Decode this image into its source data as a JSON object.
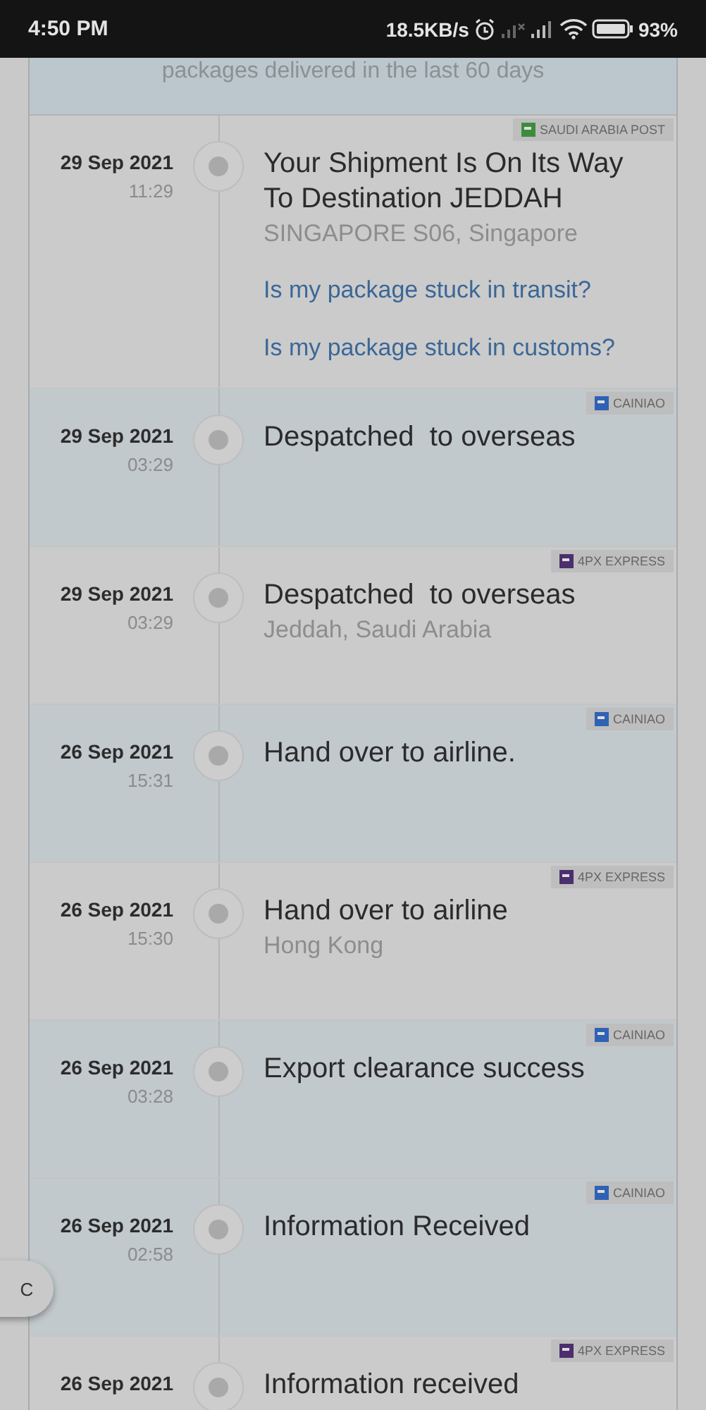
{
  "status_bar": {
    "time": "4:50 PM",
    "speed": "18.5KB/s",
    "battery": "93%"
  },
  "banner": {
    "text": "packages delivered in the last 60 days"
  },
  "events": [
    {
      "date": "29 Sep 2021",
      "time": "11:29",
      "title": "Your Shipment Is On Its Way To Destination JEDDAH",
      "location": "SINGAPORE S06, Singapore",
      "carrier": {
        "name": "SAUDI ARABIA POST",
        "kind": "saudi"
      },
      "links": [
        "Is my package stuck in transit?",
        "Is my package stuck in customs?"
      ]
    },
    {
      "date": "29 Sep 2021",
      "time": "03:29",
      "title": "Despatched  to overseas",
      "carrier": {
        "name": "CAINIAO",
        "kind": "cainiao"
      }
    },
    {
      "date": "29 Sep 2021",
      "time": "03:29",
      "title": "Despatched  to overseas",
      "location": "Jeddah, Saudi Arabia",
      "carrier": {
        "name": "4PX EXPRESS",
        "kind": "fourpx"
      }
    },
    {
      "date": "26 Sep 2021",
      "time": "15:31",
      "title": "Hand over to airline.",
      "carrier": {
        "name": "CAINIAO",
        "kind": "cainiao"
      }
    },
    {
      "date": "26 Sep 2021",
      "time": "15:30",
      "title": "Hand over to airline",
      "location": "Hong Kong",
      "carrier": {
        "name": "4PX EXPRESS",
        "kind": "fourpx"
      }
    },
    {
      "date": "26 Sep 2021",
      "time": "03:28",
      "title": "Export clearance success",
      "carrier": {
        "name": "CAINIAO",
        "kind": "cainiao"
      }
    },
    {
      "date": "26 Sep 2021",
      "time": "02:58",
      "title": "Information Received",
      "carrier": {
        "name": "CAINIAO",
        "kind": "cainiao"
      }
    },
    {
      "date": "26 Sep 2021",
      "title": "Information received",
      "carrier": {
        "name": "4PX EXPRESS",
        "kind": "fourpx"
      }
    }
  ],
  "floating_button": {
    "label": "C"
  }
}
